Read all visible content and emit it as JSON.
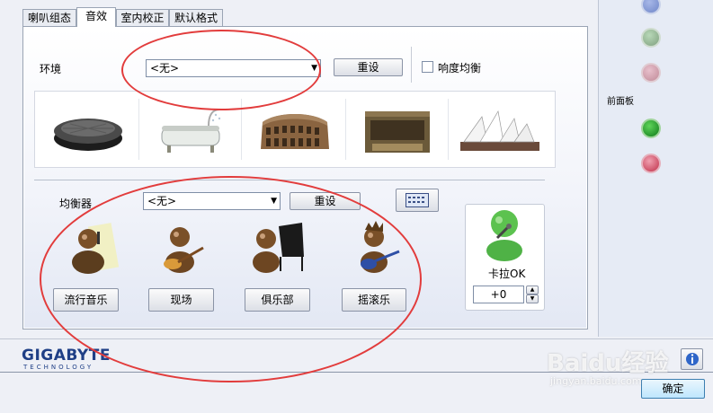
{
  "tabs": [
    "喇叭组态",
    "音效",
    "室内校正",
    "默认格式"
  ],
  "environment": {
    "label": "环境",
    "selected": "<无>",
    "reset_label": "重设",
    "loudness_label": "响度均衡",
    "loudness_checked": false
  },
  "equalizer": {
    "label": "均衡器",
    "selected": "<无>",
    "reset_label": "重设",
    "presets": [
      "流行音乐",
      "现场",
      "俱乐部",
      "摇滚乐"
    ]
  },
  "karaoke": {
    "label": "卡拉OK",
    "value": "+0"
  },
  "side": {
    "front_panel_label": "前面板"
  },
  "brand": {
    "logo": "GIGABYTE",
    "tagline": "TECHNOLOGY"
  },
  "ok_label": "确定",
  "watermark": {
    "main": "Baidu经验",
    "sub": "jingyan.baidu.com"
  },
  "colors": {
    "annotation": "#e23c3c",
    "jack_blue": "#6f86c8",
    "jack_green": "#2a9a3a",
    "jack_pink": "#d26a80"
  }
}
